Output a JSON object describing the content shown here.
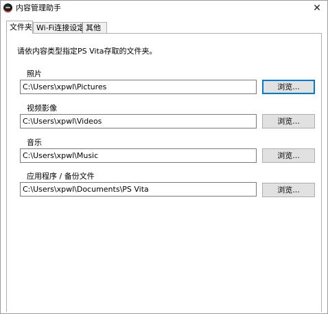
{
  "window": {
    "title": "内容管理助手",
    "close_glyph": "✕"
  },
  "tabs": [
    {
      "label": "文件夹",
      "active": true
    },
    {
      "label": "Wi-Fi连接设定",
      "active": false
    },
    {
      "label": "其他",
      "active": false
    }
  ],
  "instruction": "请依内容类型指定PS Vita存取的文件夹。",
  "folders": [
    {
      "label": "照片",
      "path": "C:\\Users\\xpwl\\Pictures",
      "button": "浏览..."
    },
    {
      "label": "视频影像",
      "path": "C:\\Users\\xpwl\\Videos",
      "button": "浏览..."
    },
    {
      "label": "音乐",
      "path": "C:\\Users\\xpwl\\Music",
      "button": "浏览..."
    },
    {
      "label": "应用程序 / 备份文件",
      "path": "C:\\Users\\xpwl\\Documents\\PS Vita",
      "button": "浏览..."
    }
  ],
  "colors": {
    "focus_accent": "#0078d7",
    "button_face": "#e1e1e1"
  }
}
